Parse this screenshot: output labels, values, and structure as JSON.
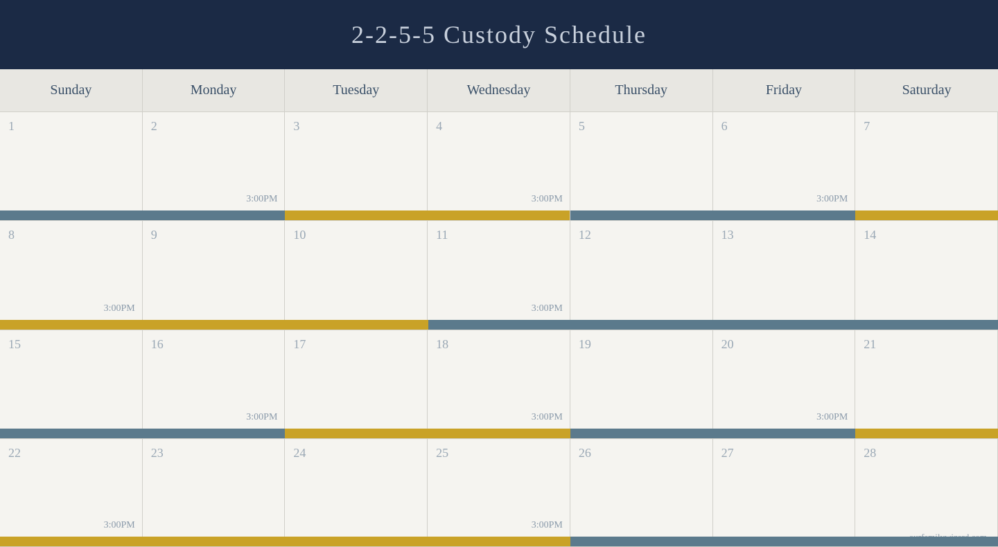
{
  "header": {
    "title": "2-2-5-5 Custody Schedule"
  },
  "days": {
    "headers": [
      "Sunday",
      "Monday",
      "Tuesday",
      "Wednesday",
      "Thursday",
      "Friday",
      "Saturday"
    ]
  },
  "rows": [
    {
      "cells": [
        {
          "number": "1",
          "time": ""
        },
        {
          "number": "2",
          "time": "3:00PM"
        },
        {
          "number": "3",
          "time": ""
        },
        {
          "number": "4",
          "time": "3:00PM"
        },
        {
          "number": "5",
          "time": ""
        },
        {
          "number": "6",
          "time": "3:00PM"
        },
        {
          "number": "7",
          "time": ""
        }
      ]
    },
    {
      "cells": [
        {
          "number": "8",
          "time": "3:00PM"
        },
        {
          "number": "9",
          "time": ""
        },
        {
          "number": "10",
          "time": ""
        },
        {
          "number": "11",
          "time": "3:00PM"
        },
        {
          "number": "12",
          "time": ""
        },
        {
          "number": "13",
          "time": ""
        },
        {
          "number": "14",
          "time": ""
        }
      ]
    },
    {
      "cells": [
        {
          "number": "15",
          "time": ""
        },
        {
          "number": "16",
          "time": "3:00PM"
        },
        {
          "number": "17",
          "time": ""
        },
        {
          "number": "18",
          "time": "3:00PM"
        },
        {
          "number": "19",
          "time": ""
        },
        {
          "number": "20",
          "time": "3:00PM"
        },
        {
          "number": "21",
          "time": ""
        }
      ]
    },
    {
      "cells": [
        {
          "number": "22",
          "time": "3:00PM"
        },
        {
          "number": "23",
          "time": ""
        },
        {
          "number": "24",
          "time": ""
        },
        {
          "number": "25",
          "time": "3:00PM"
        },
        {
          "number": "26",
          "time": ""
        },
        {
          "number": "27",
          "time": ""
        },
        {
          "number": "28",
          "time": ""
        }
      ]
    }
  ],
  "watermark": "ourfamilywizard.com"
}
